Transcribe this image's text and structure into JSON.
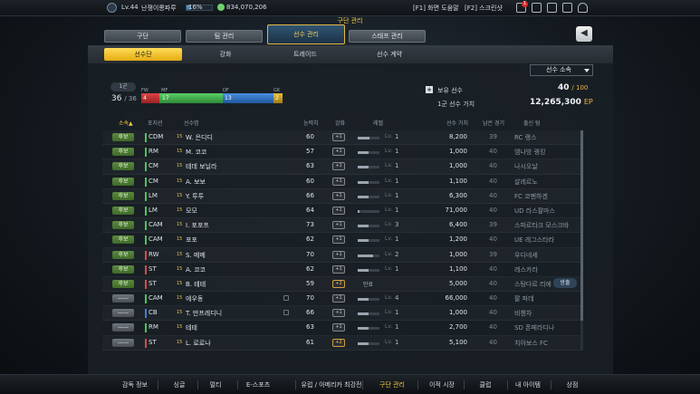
{
  "topbar": {
    "level": "Lv.44",
    "manager_name": "난쟁이롱파루",
    "exp_percent": "16%",
    "exp_fraction": 0.16,
    "coins": "834,070,206",
    "help": "[F1] 화면 도움말",
    "screenshot": "[F2] 스크린샷",
    "notification_count": "1"
  },
  "section_title": "구단 관리",
  "main_tabs": [
    "구단",
    "팀 관리",
    "선수 관리",
    "스태프 관리"
  ],
  "sub_tabs": [
    "선수단",
    "강화",
    "트레이드",
    "선수 계약"
  ],
  "filter": {
    "selected": "선수 소속"
  },
  "squad": {
    "tab": "1군",
    "count": "36",
    "max": "/ 36",
    "pos_labels": [
      "FW",
      "MF",
      "DF",
      "GK"
    ],
    "pos_counts": [
      "4",
      "17",
      "13",
      "2"
    ]
  },
  "registered": {
    "label": "보유 선수",
    "value": "40",
    "max": "/ 100"
  },
  "value_info": {
    "label": "1군 선수 가치",
    "value": "12,265,300",
    "unit": "EP"
  },
  "headers": [
    "소속",
    "포지션",
    "선수명",
    "능력치",
    "강화",
    "레벨",
    "선수 가치",
    "남은 경기",
    "출신 팀"
  ],
  "players": [
    {
      "status": "후보",
      "pos": "CDM",
      "name": "W. 은디디",
      "ovr": "60",
      "enh": "+1",
      "lv": "1",
      "value": "8,200",
      "games": "39",
      "team": "RC 랭스",
      "lv_frac": 0.55
    },
    {
      "status": "후보",
      "pos": "RM",
      "name": "M. 코코",
      "ovr": "57",
      "enh": "+1",
      "lv": "1",
      "value": "1,000",
      "games": "40",
      "team": "엠나방 랭킹",
      "lv_frac": 0.5
    },
    {
      "status": "후보",
      "pos": "CM",
      "name": "테데 보닐라",
      "ovr": "63",
      "enh": "+1",
      "lv": "1",
      "value": "1,000",
      "games": "40",
      "team": "나시오날",
      "lv_frac": 0.5
    },
    {
      "status": "후보",
      "pos": "CM",
      "name": "A. 보보",
      "ovr": "60",
      "enh": "+1",
      "lv": "1",
      "value": "1,100",
      "games": "40",
      "team": "살레르노",
      "lv_frac": 0.5
    },
    {
      "status": "후보",
      "pos": "LM",
      "name": "Y. 투투",
      "ovr": "66",
      "enh": "+1",
      "lv": "1",
      "value": "6,300",
      "games": "40",
      "team": "FC 코펜하겐",
      "lv_frac": 0.5
    },
    {
      "status": "후보",
      "pos": "LM",
      "name": "모모",
      "ovr": "64",
      "enh": "+1",
      "lv": "1",
      "value": "71,000",
      "games": "40",
      "team": "UD 라스팔마스",
      "lv_frac": 0.1
    },
    {
      "status": "후보",
      "pos": "CAM",
      "name": "I. 포포프",
      "ovr": "73",
      "enh": "+1",
      "lv": "3",
      "value": "6,400",
      "games": "39",
      "team": "스파르타크 모스크바",
      "lv_frac": 0.5
    },
    {
      "status": "후보",
      "pos": "CAM",
      "name": "포포",
      "ovr": "62",
      "enh": "+1",
      "lv": "1",
      "value": "1,200",
      "games": "40",
      "team": "UE 레그스타라",
      "lv_frac": 0.5
    },
    {
      "status": "후보",
      "pos": "RW",
      "name": "S. 메메",
      "ovr": "70",
      "enh": "+1",
      "lv": "2",
      "value": "1,000",
      "games": "39",
      "team": "우디네세",
      "lv_frac": 0.7
    },
    {
      "status": "후보",
      "pos": "ST",
      "name": "A. 코코",
      "ovr": "62",
      "enh": "+1",
      "lv": "1",
      "value": "1,100",
      "games": "40",
      "team": "레스카라",
      "lv_frac": 0.5
    },
    {
      "status": "후보",
      "pos": "ST",
      "name": "B. 테테",
      "ovr": "59",
      "enh": "+2",
      "lv": "",
      "value": "5,000",
      "games": "40",
      "team": "스탕다르 리에",
      "lv_frac": 0.0,
      "badge": "만료",
      "tip": "방출"
    },
    {
      "status": "——",
      "pos": "CAM",
      "name": "에우동",
      "ovr": "70",
      "enh": "+1",
      "lv": "4",
      "value": "66,000",
      "games": "40",
      "team": "팔 파데",
      "lv_frac": 0.5
    },
    {
      "status": "——",
      "pos": "CB",
      "name": "T. 만프레디니",
      "ovr": "66",
      "enh": "+1",
      "lv": "1",
      "value": "1,000",
      "games": "40",
      "team": "비첸차",
      "lv_frac": 0.5
    },
    {
      "status": "——",
      "pos": "RM",
      "name": "테테",
      "ovr": "63",
      "enh": "+1",
      "lv": "1",
      "value": "2,700",
      "games": "40",
      "team": "SD 폰페라디나",
      "lv_frac": 0.5
    },
    {
      "status": "——",
      "pos": "ST",
      "name": "L. 로로나",
      "ovr": "61",
      "enh": "+2",
      "lv": "1",
      "value": "5,100",
      "games": "40",
      "team": "치아보스 FC",
      "lv_frac": 0.5
    }
  ],
  "bottom_nav": [
    "감독 정보",
    "싱글",
    "멀티",
    "E-스포츠",
    "유럽 / 아메리카 최강전",
    "구단 관리",
    "이적 시장",
    "클럽",
    "내 아이템",
    "상점"
  ],
  "colors": {
    "accent": "#f5c842",
    "status_green": "#4f7c34",
    "fw": "#c33a3a",
    "mf": "#3fb54a",
    "df": "#2d6fc6",
    "gk": "#d0a428"
  }
}
